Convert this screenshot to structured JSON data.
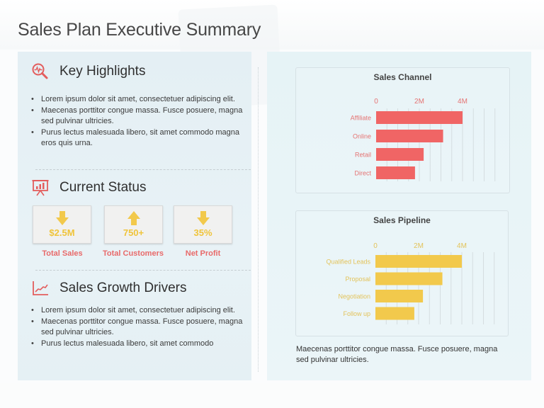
{
  "page": {
    "title": "Sales Plan Executive Summary"
  },
  "key_highlights": {
    "title": "Key Highlights",
    "icon": "magnifier-pulse-icon",
    "bullets": [
      "Lorem ipsum dolor sit amet, consectetuer adipiscing elit.",
      "Maecenas porttitor  congue massa. Fusce posuere, magna sed pulvinar ultricies.",
      "Purus lectus malesuada libero, sit amet commodo magna eros quis urna."
    ]
  },
  "current_status": {
    "title": "Current Status",
    "icon": "presentation-chart-icon",
    "stats": [
      {
        "value": "$2.5M",
        "label": "Total Sales",
        "trend": "down",
        "icon": "arrow-down-icon"
      },
      {
        "value": "750+",
        "label": "Total Customers",
        "trend": "up",
        "icon": "arrow-up-icon"
      },
      {
        "value": "35%",
        "label": "Net Profit",
        "trend": "down",
        "icon": "arrow-down-icon"
      }
    ]
  },
  "sales_growth_drivers": {
    "title": "Sales Growth Drivers",
    "icon": "line-chart-icon",
    "bullets": [
      "Lorem ipsum dolor sit amet, consectetuer adipiscing elit.",
      "Maecenas porttitor  congue massa. Fusce posuere, magna sed pulvinar ultricies.",
      "Purus lectus malesuada libero, sit amet commodo"
    ]
  },
  "colors": {
    "accent_red": "#f06565",
    "accent_yellow": "#f2c94c",
    "label_red": "#e86a6a",
    "value_yellow": "#f0c43a"
  },
  "chart_data": [
    {
      "type": "bar",
      "orientation": "horizontal",
      "title": "Sales Channel",
      "categories": [
        "Affiliate",
        "Online",
        "Retail",
        "Direct"
      ],
      "values": [
        4000000,
        3100000,
        2200000,
        1800000
      ],
      "xlim": [
        0,
        5000000
      ],
      "x_ticks": [
        0,
        2000000,
        4000000
      ],
      "x_tick_labels": [
        "0",
        "2M",
        "4M"
      ],
      "xlabel": "",
      "ylabel": "",
      "grid": true,
      "axis_position": "top",
      "color": "#f06565",
      "label_color": "#e57373"
    },
    {
      "type": "bar",
      "orientation": "horizontal",
      "title": "Sales Pipeline",
      "categories": [
        "Qualified Leads",
        "Proposal",
        "Negotiation",
        "Follow up"
      ],
      "values": [
        4000000,
        3100000,
        2200000,
        1800000
      ],
      "xlim": [
        0,
        5000000
      ],
      "x_ticks": [
        0,
        2000000,
        4000000
      ],
      "x_tick_labels": [
        "0",
        "2M",
        "4M"
      ],
      "xlabel": "",
      "ylabel": "",
      "grid": true,
      "axis_position": "top",
      "color": "#f2c94c",
      "label_color": "#e3c35a"
    }
  ],
  "caption": "Maecenas porttitor  congue massa. Fusce posuere, magna sed pulvinar ultricies."
}
